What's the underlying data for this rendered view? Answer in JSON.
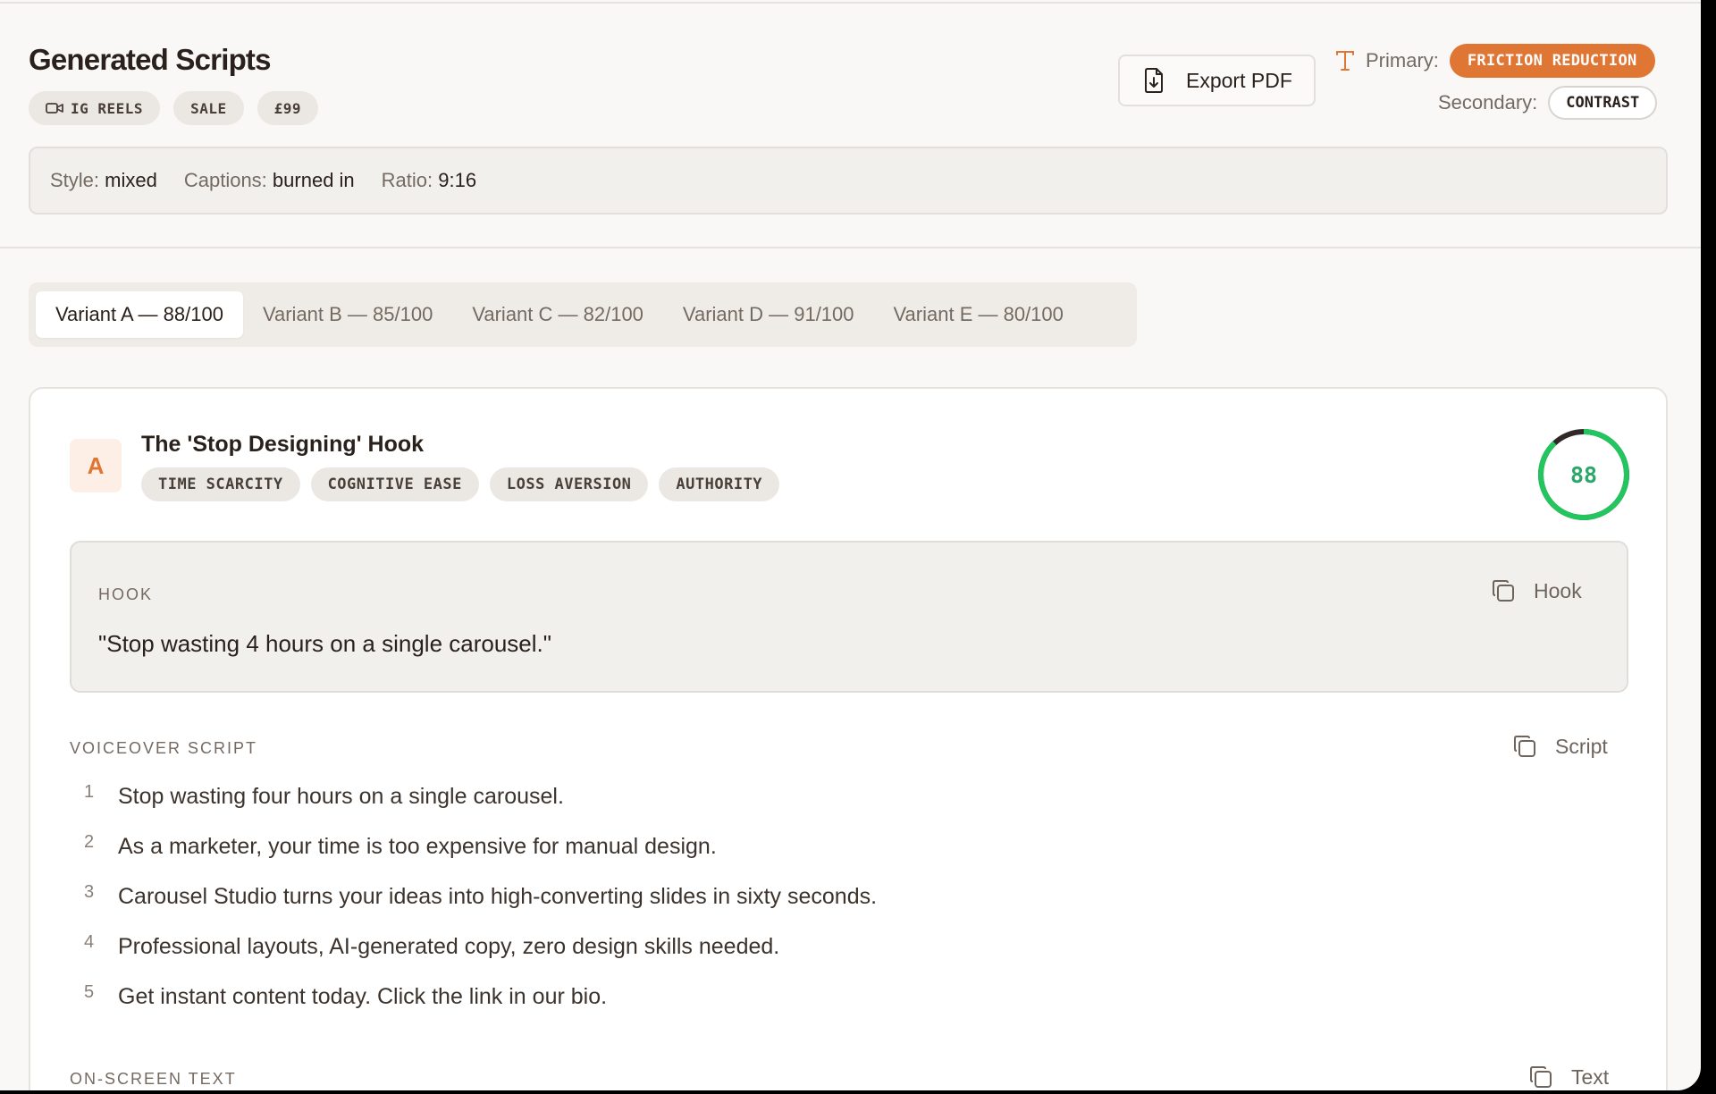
{
  "header": {
    "title": "Generated Scripts",
    "chips": [
      {
        "label": "IG REELS",
        "icon": "video-camera-icon"
      },
      {
        "label": "SALE"
      },
      {
        "label": "£99"
      }
    ],
    "settings": [
      {
        "key": "Style:",
        "value": "mixed"
      },
      {
        "key": "Captions:",
        "value": "burned in"
      },
      {
        "key": "Ratio:",
        "value": "9:16"
      }
    ],
    "export_label": "Export PDF",
    "primary_label": "Primary:",
    "primary_value": "FRICTION REDUCTION",
    "secondary_label": "Secondary:",
    "secondary_value": "CONTRAST"
  },
  "tabs": [
    {
      "label": "Variant A — 88/100",
      "active": true
    },
    {
      "label": "Variant B — 85/100",
      "active": false
    },
    {
      "label": "Variant C — 82/100",
      "active": false
    },
    {
      "label": "Variant D — 91/100",
      "active": false
    },
    {
      "label": "Variant E — 80/100",
      "active": false
    }
  ],
  "variant": {
    "letter": "A",
    "title": "The 'Stop Designing' Hook",
    "tags": [
      "TIME SCARCITY",
      "COGNITIVE EASE",
      "LOSS AVERSION",
      "AUTHORITY"
    ],
    "score": "88",
    "score_value": 88,
    "score_max": 100,
    "hook": {
      "label": "HOOK",
      "copy_label": "Hook",
      "text": "\"Stop wasting 4 hours on a single carousel.\""
    },
    "voiceover": {
      "label": "VOICEOVER SCRIPT",
      "copy_label": "Script",
      "lines": [
        {
          "n": "1",
          "text": "Stop wasting four hours on a single carousel."
        },
        {
          "n": "2",
          "text": "As a marketer, your time is too expensive for manual design."
        },
        {
          "n": "3",
          "text": "Carousel Studio turns your ideas into high-converting slides in sixty seconds."
        },
        {
          "n": "4",
          "text": "Professional layouts, AI-generated copy, zero design skills needed."
        },
        {
          "n": "5",
          "text": "Get instant content today. Click the link in our bio."
        }
      ]
    },
    "onscreen": {
      "label": "ON-SCREEN TEXT",
      "copy_label": "Text"
    }
  },
  "colors": {
    "accent": "#e07633",
    "score_green": "#22c55e",
    "score_track_dark": "#2f2a27"
  }
}
